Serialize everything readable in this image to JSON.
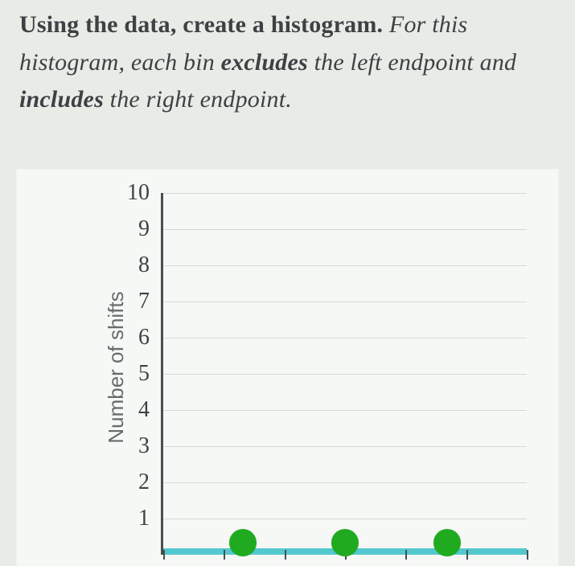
{
  "instruction": {
    "lead_bold": "Using the data, create a histogram.",
    "rest_1": " For this histogram, each bin ",
    "kw_excludes": "excludes",
    "rest_2": " the left endpoint and ",
    "kw_includes": "includes",
    "rest_3": " the right endpoint."
  },
  "chart_data": {
    "type": "bar",
    "title": "",
    "xlabel": "",
    "ylabel": "Number of shifts",
    "ylim": [
      0,
      10
    ],
    "yticks": [
      1,
      2,
      3,
      4,
      5,
      6,
      7,
      8,
      9,
      10
    ],
    "categories": [
      "bin1",
      "bin2",
      "bin3"
    ],
    "values": [
      0,
      0,
      0
    ],
    "xtick_count": 7,
    "handle_positions_pct": [
      22,
      50,
      78
    ]
  }
}
